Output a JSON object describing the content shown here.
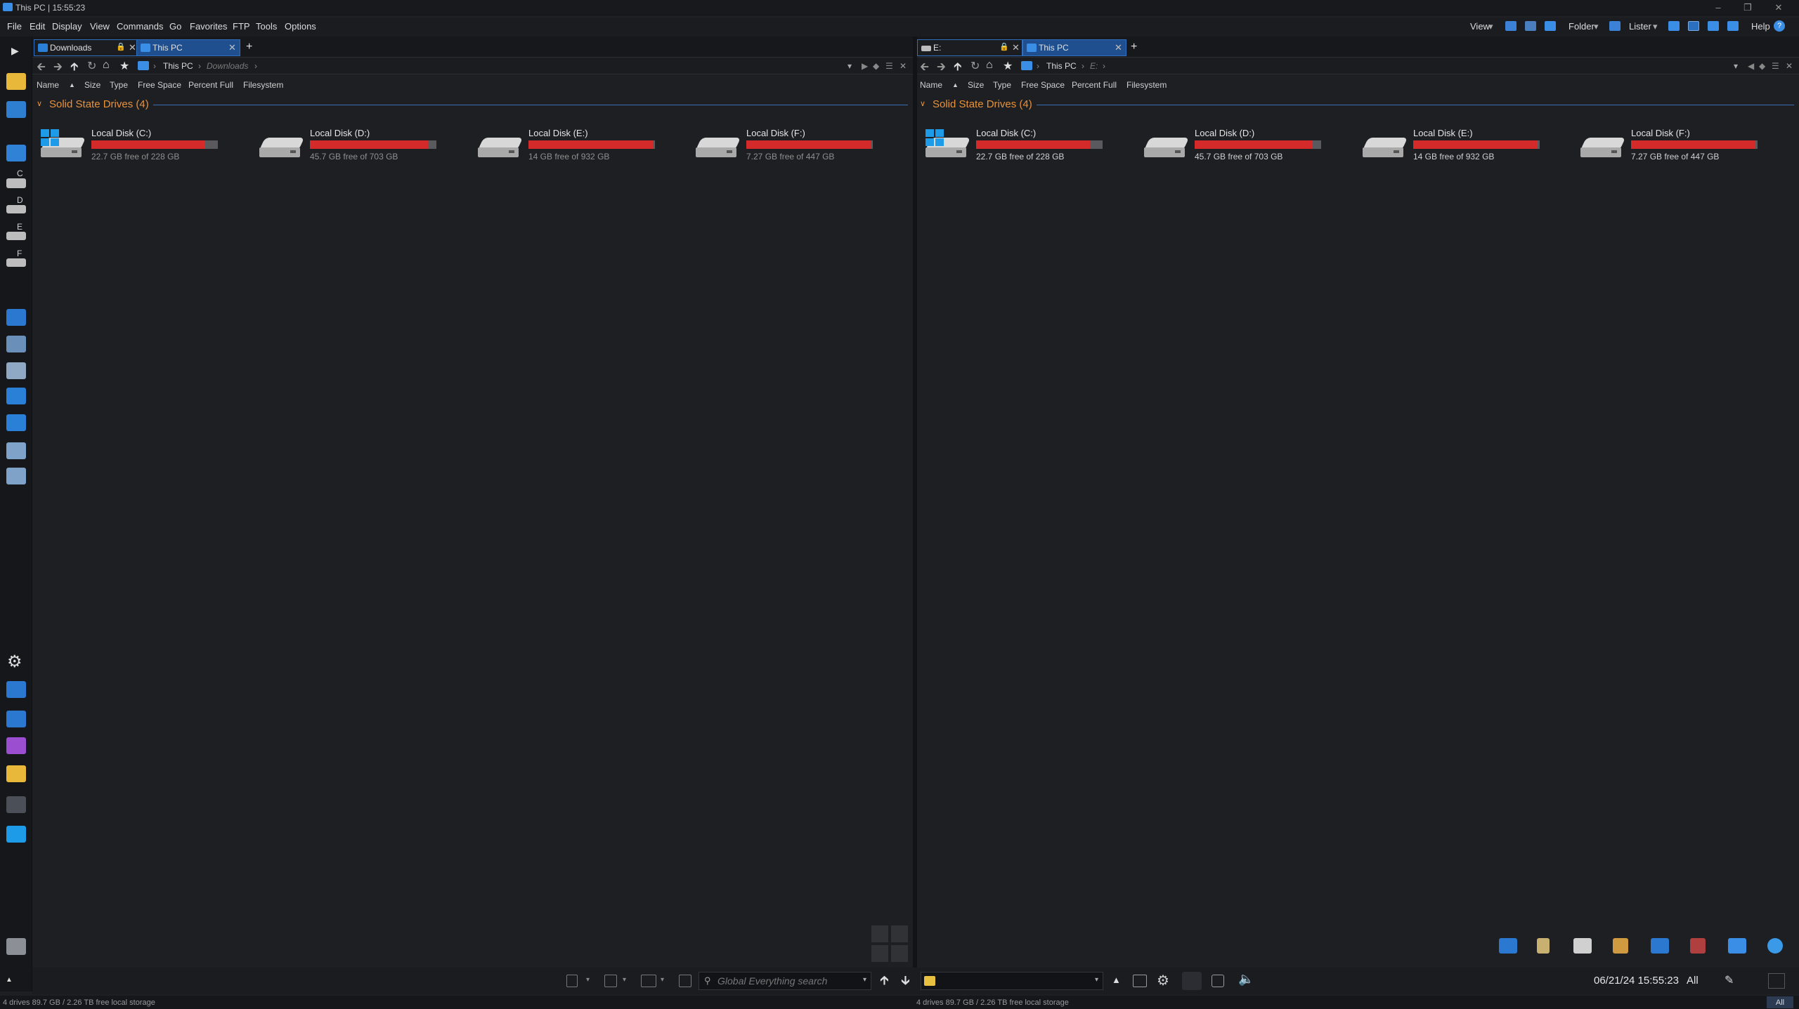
{
  "window": {
    "title": "This PC | 15:55:23"
  },
  "menu": [
    "File",
    "Edit",
    "Display",
    "View",
    "Commands",
    "Go",
    "Favorites",
    "FTP",
    "Tools",
    "Options"
  ],
  "toolbar_right": {
    "view": "View",
    "folder": "Folder",
    "lister": "Lister",
    "help": "Help"
  },
  "left_sidebar": {
    "letters": [
      "C",
      "D",
      "E",
      "F"
    ]
  },
  "panes": [
    {
      "tabs": [
        {
          "label": "Downloads",
          "locked": true,
          "active": false
        },
        {
          "label": "This PC",
          "active": true
        }
      ],
      "breadcrumb": [
        "This PC",
        "Downloads"
      ],
      "columns": [
        "Name",
        "Size",
        "Type",
        "Free Space",
        "Percent Full",
        "Filesystem"
      ],
      "group_title": "Solid State Drives (4)",
      "drives": [
        {
          "name": "Local Disk (C:)",
          "free": "22.7 GB free of 228 GB",
          "used_fraction": 0.9,
          "system": true
        },
        {
          "name": "Local Disk (D:)",
          "free": "45.7 GB free of 703 GB",
          "used_fraction": 0.935
        },
        {
          "name": "Local Disk (E:)",
          "free": "14 GB free of 932 GB",
          "used_fraction": 0.985
        },
        {
          "name": "Local Disk (F:)",
          "free": "7.27 GB free of 447 GB",
          "used_fraction": 0.984
        }
      ],
      "status": "4 drives  89.7 GB / 2.26 TB free local storage"
    },
    {
      "tabs": [
        {
          "label": "E:",
          "locked": true,
          "active": false
        },
        {
          "label": "This PC",
          "active": true
        }
      ],
      "breadcrumb": [
        "This PC",
        "E:"
      ],
      "columns": [
        "Name",
        "Size",
        "Type",
        "Free Space",
        "Percent Full",
        "Filesystem"
      ],
      "group_title": "Solid State Drives (4)",
      "drives": [
        {
          "name": "Local Disk (C:)",
          "free": "22.7 GB free of 228 GB",
          "used_fraction": 0.9,
          "system": true
        },
        {
          "name": "Local Disk (D:)",
          "free": "45.7 GB free of 703 GB",
          "used_fraction": 0.935
        },
        {
          "name": "Local Disk (E:)",
          "free": "14 GB free of 932 GB",
          "used_fraction": 0.985
        },
        {
          "name": "Local Disk (F:)",
          "free": "7.27 GB free of 447 GB",
          "used_fraction": 0.984
        }
      ],
      "status": "4 drives  89.7 GB / 2.26 TB free local storage"
    }
  ],
  "bottom": {
    "search_placeholder": "Global Everything search",
    "clock": "06/21/24 15:55:23",
    "filter": "All",
    "all_button": "All"
  },
  "colors": {
    "accent": "#2f6fc0",
    "group": "#e8923a",
    "bar_fill": "#d52a2a",
    "bar_bg": "#5a5a5e"
  }
}
